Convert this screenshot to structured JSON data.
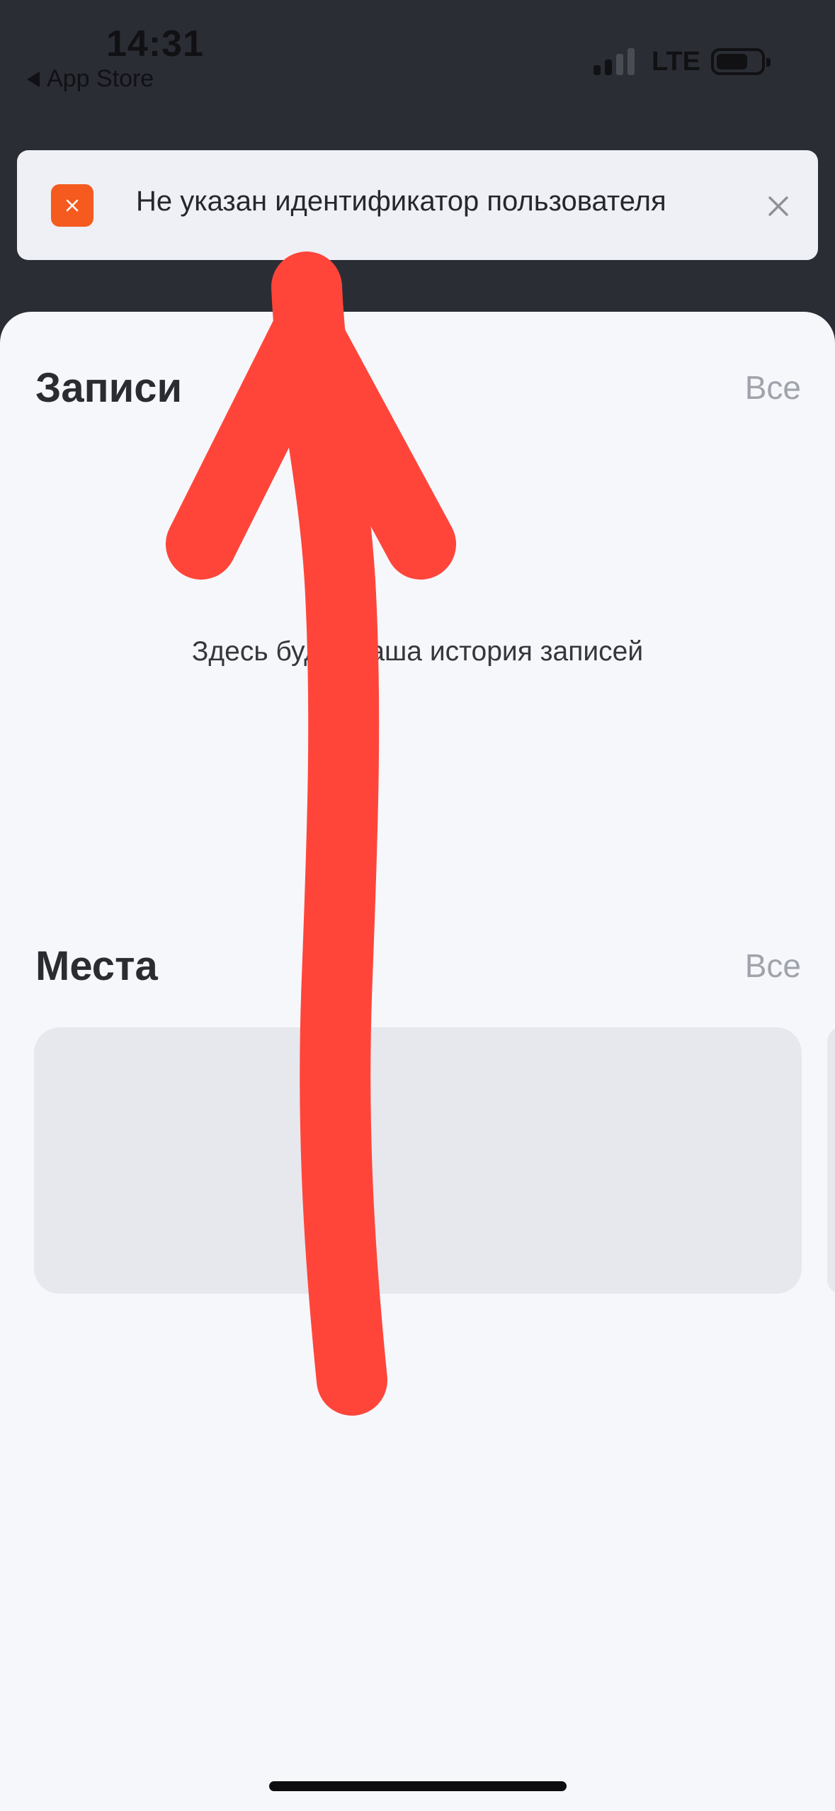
{
  "status_bar": {
    "time": "14:31",
    "back_label": "App Store",
    "network": "LTE"
  },
  "toast": {
    "message": "Не указан идентификатор пользователя",
    "icon": "error-x-icon",
    "close_icon": "close-icon",
    "accent_color": "#f55a1f"
  },
  "records": {
    "title": "Записи",
    "all_label": "Все",
    "empty_text": "Здесь будет ваша история записей"
  },
  "places": {
    "title": "Места",
    "all_label": "Все"
  },
  "annotation": {
    "icon": "arrow-up-annotation",
    "color": "#ff453a"
  }
}
